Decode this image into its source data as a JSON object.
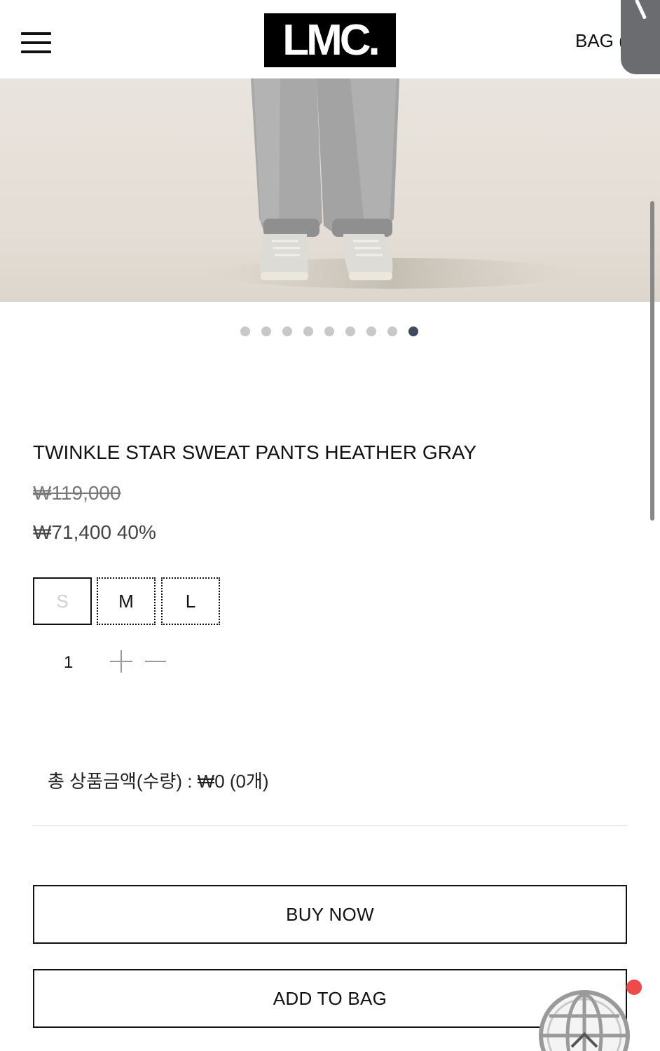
{
  "header": {
    "logo_text": "LMC.",
    "bag_label": "BAG ("
  },
  "gallery": {
    "slide_count": 9,
    "active_index": 8
  },
  "product": {
    "title": "TWINKLE STAR SWEAT PANTS HEATHER GRAY",
    "original_price": "₩119,000",
    "sale_price": "₩71,400 40%",
    "sizes": [
      {
        "label": "S",
        "available": false
      },
      {
        "label": "M",
        "available": true
      },
      {
        "label": "L",
        "available": true
      }
    ],
    "quantity": "1"
  },
  "summary": {
    "total_text": "총 상품금액(수량) : ₩0 (0개)"
  },
  "actions": {
    "buy_now": "BUY NOW",
    "add_to_bag": "ADD TO BAG"
  },
  "colors": {
    "active_dot": "#3f4a5c",
    "notification": "#ee4a4a"
  }
}
